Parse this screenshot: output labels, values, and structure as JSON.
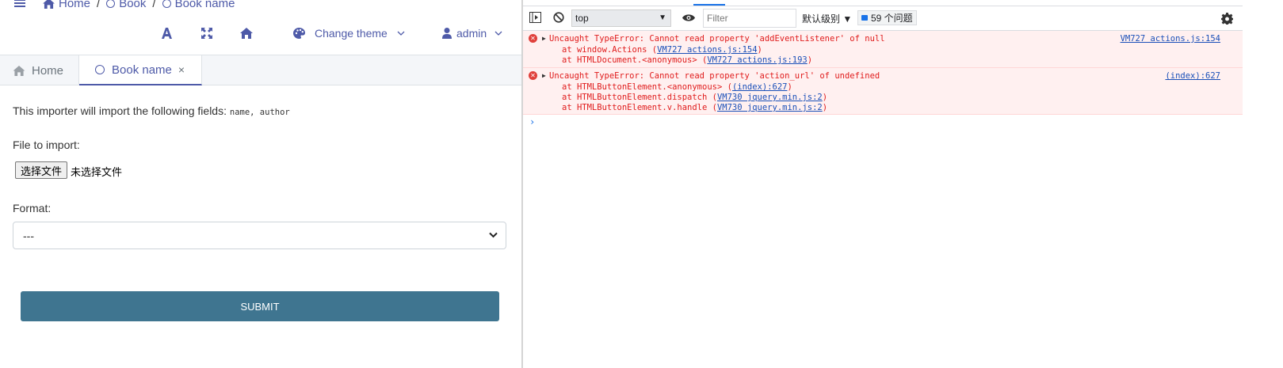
{
  "breadcrumb": {
    "items": [
      "Home",
      "Book",
      "Book name"
    ],
    "separator": "/"
  },
  "toolbar": {
    "change_theme": "Change theme",
    "user": "admin"
  },
  "tabs": [
    {
      "label": "Home"
    },
    {
      "label": "Book name",
      "close": "×"
    }
  ],
  "form": {
    "intro_text": "This importer will import the following fields: ",
    "intro_fields": "name, author",
    "file_label": "File to import:",
    "file_button": "选择文件",
    "file_status": "未选择文件",
    "format_label": "Format:",
    "format_selected": "---",
    "submit_label": "SUBMIT"
  },
  "devtools": {
    "context": "top",
    "filter_placeholder": "Filter",
    "levels": "默认级别 ▼",
    "issues": "59 个问题",
    "messages": [
      {
        "text": "Uncaught TypeError: Cannot read property 'addEventListener' of null",
        "source": "VM727 actions.js:154",
        "stack": [
          {
            "prefix": "at window.Actions (",
            "link": "VM727 actions.js:154",
            "suffix": ")"
          },
          {
            "prefix": "at HTMLDocument.<anonymous> (",
            "link": "VM727 actions.js:193",
            "suffix": ")"
          }
        ]
      },
      {
        "text": "Uncaught TypeError: Cannot read property 'action_url' of undefined",
        "source": "(index):627",
        "stack": [
          {
            "prefix": "at HTMLButtonElement.<anonymous> (",
            "link": "(index):627",
            "suffix": ")"
          },
          {
            "prefix": "at HTMLButtonElement.dispatch (",
            "link": "VM730 jquery.min.js:2",
            "suffix": ")"
          },
          {
            "prefix": "at HTMLButtonElement.v.handle (",
            "link": "VM730 jquery.min.js:2",
            "suffix": ")"
          }
        ]
      }
    ],
    "prompt": "›"
  },
  "colors": {
    "accent": "#4e5aa8",
    "submit_bg": "#3f7590",
    "error_bg": "#fff0f0",
    "error_text": "#e01c1c"
  }
}
